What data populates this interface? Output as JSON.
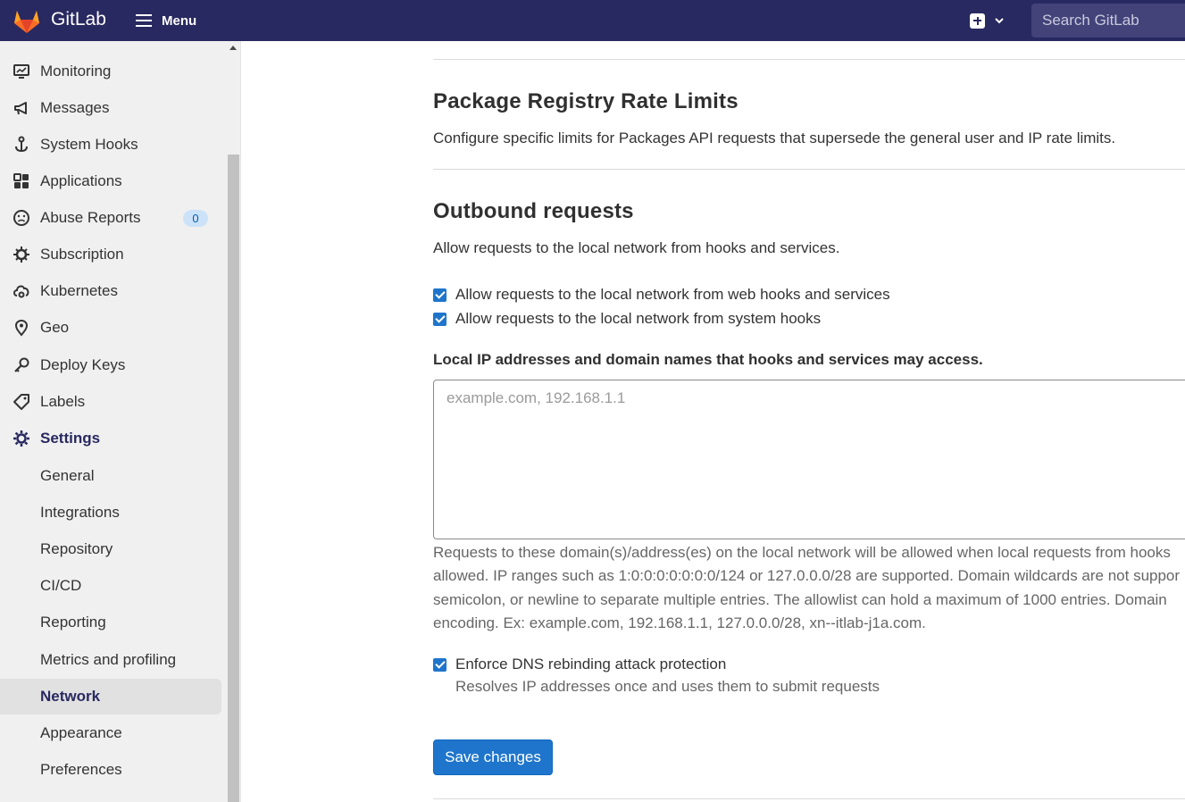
{
  "navbar": {
    "brand": "GitLab",
    "menu_label": "Menu",
    "search_placeholder": "Search GitLab",
    "bg_color": "#292961"
  },
  "sidebar": {
    "items": [
      {
        "label": "Monitoring",
        "icon": "monitor-icon"
      },
      {
        "label": "Messages",
        "icon": "bullhorn-icon"
      },
      {
        "label": "System Hooks",
        "icon": "hook-icon"
      },
      {
        "label": "Applications",
        "icon": "applications-icon"
      },
      {
        "label": "Abuse Reports",
        "icon": "abuse-icon",
        "badge": "0"
      },
      {
        "label": "Subscription",
        "icon": "subscription-icon"
      },
      {
        "label": "Kubernetes",
        "icon": "cloud-gear-icon"
      },
      {
        "label": "Geo",
        "icon": "location-icon"
      },
      {
        "label": "Deploy Keys",
        "icon": "key-icon"
      },
      {
        "label": "Labels",
        "icon": "label-icon"
      },
      {
        "label": "Settings",
        "icon": "settings-icon"
      }
    ],
    "settings_subitems": [
      "General",
      "Integrations",
      "Repository",
      "CI/CD",
      "Reporting",
      "Metrics and profiling",
      "Network",
      "Appearance",
      "Preferences"
    ],
    "active_item": "Network"
  },
  "main": {
    "package_registry": {
      "title": "Package Registry Rate Limits",
      "description": "Configure specific limits for Packages API requests that supersede the general user and IP rate limits."
    },
    "outbound": {
      "title": "Outbound requests",
      "description": "Allow requests to the local network from hooks and services.",
      "checkbox_web_hooks": "Allow requests to the local network from web hooks and services",
      "checkbox_system_hooks": "Allow requests to the local network from system hooks",
      "allowlist_label": "Local IP addresses and domain names that hooks and services may access.",
      "allowlist_placeholder": "example.com, 192.168.1.1",
      "allowlist_help": [
        "Requests to these domain(s)/address(es) on the local network will be allowed when local requests from hooks",
        "allowed. IP ranges such as 1:0:0:0:0:0:0:0/124 or 127.0.0.0/28 are supported. Domain wildcards are not suppor",
        "semicolon, or newline to separate multiple entries. The allowlist can hold a maximum of 1000 entries. Domain",
        "encoding. Ex: example.com, 192.168.1.1, 127.0.0.0/28, xn--itlab-j1a.com."
      ],
      "dns_checkbox": "Enforce DNS rebinding attack protection",
      "dns_help": "Resolves IP addresses once and uses them to submit requests",
      "save_label": "Save changes"
    }
  }
}
